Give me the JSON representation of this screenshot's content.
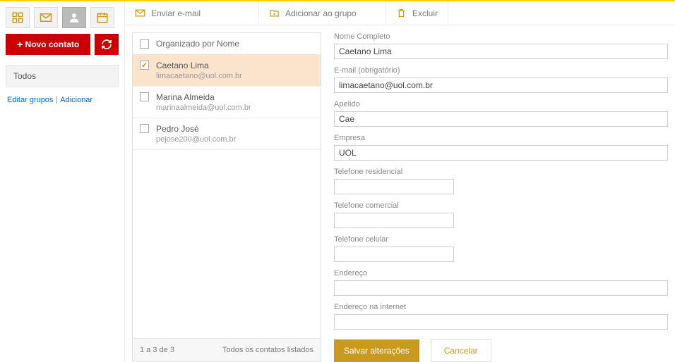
{
  "sidebar": {
    "new_contact_label": "Novo contato",
    "groups_title": "Todos",
    "edit_groups_label": "Editar grupos",
    "add_group_label": "Adicionar"
  },
  "actions": {
    "send_email": "Enviar e-mail",
    "add_to_group": "Adicionar ao grupo",
    "delete": "Excluir"
  },
  "list": {
    "header": "Organizado por Nome",
    "contacts": [
      {
        "name": "Caetano Lima",
        "email": "limacaetano@uol.com.br",
        "selected": true
      },
      {
        "name": "Marina Almeida",
        "email": "marinaalmeida@uol.com.br",
        "selected": false
      },
      {
        "name": "Pedro José",
        "email": "pejose200@uol.com.br",
        "selected": false
      }
    ],
    "footer_count": "1 a 3 de 3",
    "footer_status": "Todos os contatos listados"
  },
  "form": {
    "full_name_label": "Nome Completo",
    "full_name_value": "Caetano Lima",
    "email_label": "E-mail (obrigatório)",
    "email_value": "limacaetano@uol.com.br",
    "nickname_label": "Apelido",
    "nickname_value": "Cae",
    "company_label": "Empresa",
    "company_value": "UOL",
    "phone_home_label": "Telefone residencial",
    "phone_home_value": "",
    "phone_work_label": "Telefone comercial",
    "phone_work_value": "",
    "phone_mobile_label": "Telefone celular",
    "phone_mobile_value": "",
    "address_label": "Endereço",
    "address_value": "",
    "web_label": "Endereço na internet",
    "web_value": "",
    "save_label": "Salvar alterações",
    "cancel_label": "Cancelar"
  }
}
